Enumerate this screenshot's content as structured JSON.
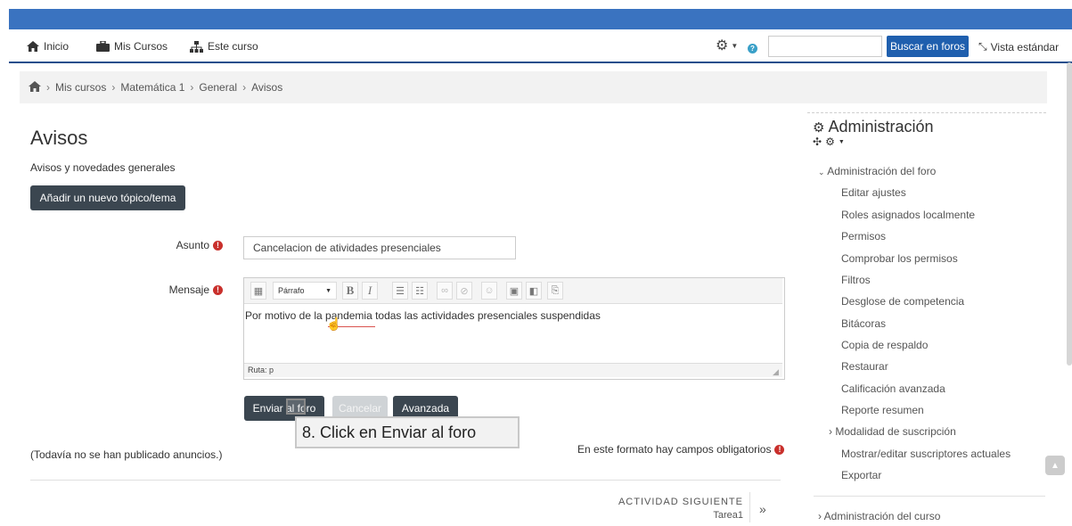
{
  "nav": {
    "home": "Inicio",
    "my_courses": "Mis Cursos",
    "this_course": "Este curso",
    "search_placeholder": "",
    "search_button": "Buscar en foros",
    "standard_view": "Vista estándar"
  },
  "breadcrumb": [
    "Mis cursos",
    "Matemática 1",
    "General",
    "Avisos"
  ],
  "page": {
    "title": "Avisos",
    "subtitle": "Avisos y novedades generales",
    "add_topic_button": "Añadir un nuevo tópico/tema"
  },
  "form": {
    "subject_label": "Asunto",
    "subject_value": "Cancelacion de atividades presenciales",
    "message_label": "Mensaje",
    "paragraph_select": "Párrafo",
    "message_text": "Por motivo de la pandemia todas las actividades presenciales suspendidas",
    "path_label": "Ruta: p",
    "submit_button": "Enviar al foro",
    "cancel_button": "Cancelar",
    "advanced_button": "Avanzada",
    "required_note": "En este formato hay campos obligatorios"
  },
  "tooltip": "8. Click en Enviar al foro",
  "no_posts": "(Todavía no se han publicado anuncios.)",
  "next_activity": {
    "label": "ACTIVIDAD SIGUIENTE",
    "name": "Tarea1"
  },
  "admin": {
    "title": "Administración",
    "forum_admin": "Administración del foro",
    "items": [
      "Editar ajustes",
      "Roles asignados localmente",
      "Permisos",
      "Comprobar los permisos",
      "Filtros",
      "Desglose de competencia",
      "Bitácoras",
      "Copia de respaldo",
      "Restaurar",
      "Calificación avanzada",
      "Reporte resumen"
    ],
    "enrolment": "Modalidad de suscripción",
    "subscribers": "Mostrar/editar suscriptores actuales",
    "export": "Exportar",
    "course_admin": "Administración del curso"
  },
  "colors": {
    "primary": "#1f5fae",
    "dark_button": "#3b4650",
    "required": "#c9302c"
  }
}
